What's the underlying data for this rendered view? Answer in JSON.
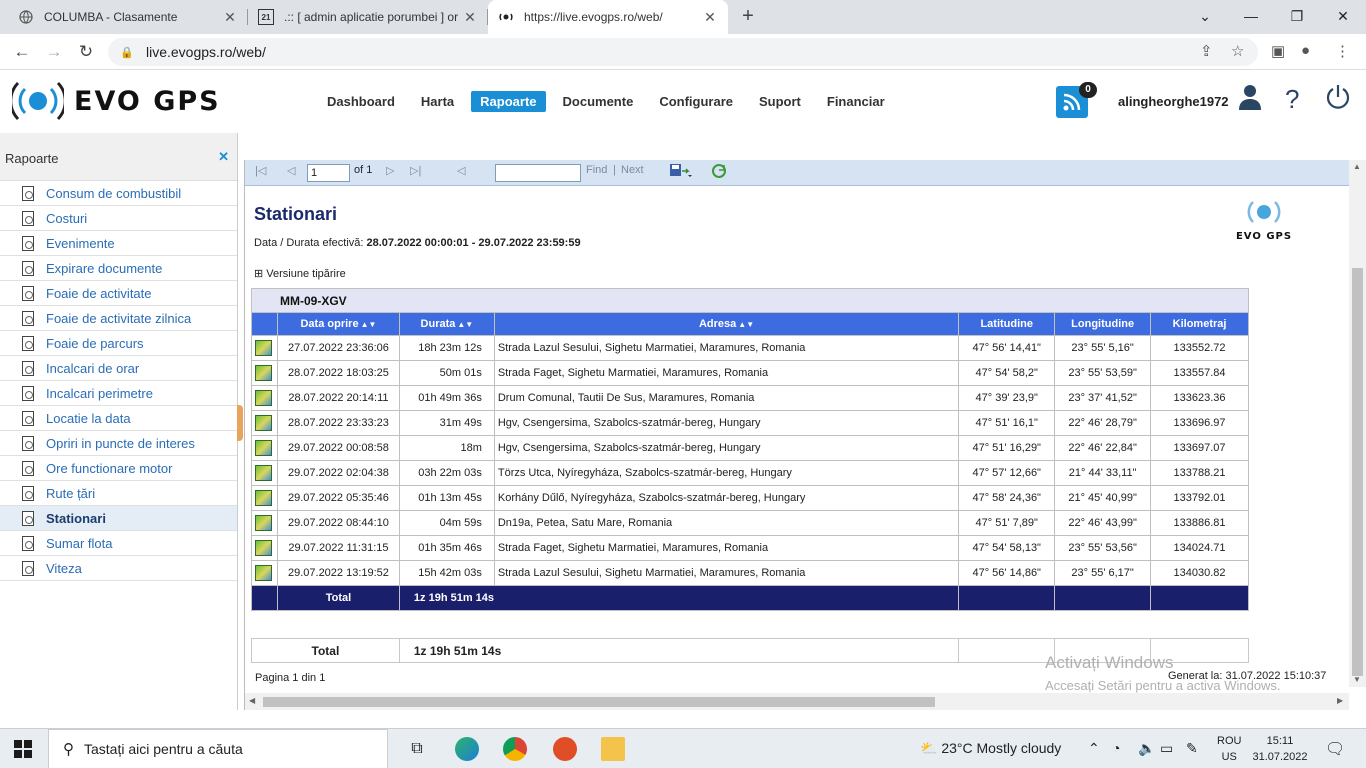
{
  "browser": {
    "tabs": [
      {
        "title": "COLUMBA - Clasamente",
        "icon": "globe-icon"
      },
      {
        "title": ".:: [ admin aplicatie porumbei ] or",
        "icon": "site-icon"
      },
      {
        "title": "https://live.evogps.ro/web/",
        "icon": "evogps-icon"
      }
    ],
    "url": "live.evogps.ro/web/"
  },
  "app": {
    "brand": "EVO GPS",
    "nav": [
      "Dashboard",
      "Harta",
      "Rapoarte",
      "Documente",
      "Configurare",
      "Suport",
      "Financiar"
    ],
    "active_nav": "Rapoarte",
    "notification_count": "0",
    "username": "alingheorghe1972"
  },
  "sidebar": {
    "title": "Rapoarte",
    "items": [
      "Consum de combustibil",
      "Costuri",
      "Evenimente",
      "Expirare documente",
      "Foaie de activitate",
      "Foaie de activitate zilnica",
      "Foaie de parcurs",
      "Incalcari de orar",
      "Incalcari perimetre",
      "Locatie la data",
      "Opriri in puncte de interes",
      "Ore functionare motor",
      "Rute țări",
      "Stationari",
      "Sumar flota",
      "Viteza"
    ],
    "selected": "Stationari"
  },
  "toolbar": {
    "page": "1",
    "of": "of 1",
    "find": "Find",
    "separator": "|",
    "next": "Next"
  },
  "report": {
    "title": "Stationari",
    "period_label": "Data / Durata efectivă:",
    "period_value": "28.07.2022 00:00:01 - 29.07.2022 23:59:59",
    "logo_text": "EVO GPS",
    "print_version": "Versiune tipărire",
    "vehicle": "MM-09-XGV",
    "columns": [
      "Data oprire",
      "Durata",
      "Adresa",
      "Latitudine",
      "Longitudine",
      "Kilometraj"
    ],
    "rows": [
      {
        "date": "27.07.2022 23:36:06",
        "duration": "18h 23m 12s",
        "address": "Strada Lazul Sesului,   Sighetu Marmatiei, Maramures, Romania",
        "lat": "47° 56' 14,41\"",
        "lon": "23° 55' 5,16\"",
        "km": "133552.72"
      },
      {
        "date": "28.07.2022 18:03:25",
        "duration": "50m 01s",
        "address": "Strada Faget,   Sighetu Marmatiei, Maramures, Romania",
        "lat": "47° 54' 58,2\"",
        "lon": "23° 55' 53,59\"",
        "km": "133557.84"
      },
      {
        "date": "28.07.2022 20:14:11",
        "duration": "01h 49m 36s",
        "address": "Drum Comunal,   Tautii De Sus, Maramures, Romania",
        "lat": "47° 39' 23,9\"",
        "lon": "23° 37' 41,52\"",
        "km": "133623.36"
      },
      {
        "date": "28.07.2022 23:33:23",
        "duration": "31m 49s",
        "address": "Hgv,   Csengersima, Szabolcs-szatmár-bereg, Hungary",
        "lat": "47° 51' 16,1\"",
        "lon": "22° 46' 28,79\"",
        "km": "133696.97"
      },
      {
        "date": "29.07.2022 00:08:58",
        "duration": "18m",
        "address": "Hgv,   Csengersima, Szabolcs-szatmár-bereg, Hungary",
        "lat": "47° 51' 16,29\"",
        "lon": "22° 46' 22,84\"",
        "km": "133697.07"
      },
      {
        "date": "29.07.2022 02:04:38",
        "duration": "03h 22m 03s",
        "address": "Törzs Utca,   Nyíregyháza, Szabolcs-szatmár-bereg, Hungary",
        "lat": "47° 57' 12,66\"",
        "lon": "21° 44' 33,11\"",
        "km": "133788.21"
      },
      {
        "date": "29.07.2022 05:35:46",
        "duration": "01h 13m 45s",
        "address": "Korhány Dűlő,   Nyíregyháza, Szabolcs-szatmár-bereg, Hungary",
        "lat": "47° 58' 24,36\"",
        "lon": "21° 45' 40,99\"",
        "km": "133792.01"
      },
      {
        "date": "29.07.2022 08:44:10",
        "duration": "04m 59s",
        "address": "Dn19a,   Petea, Satu Mare, Romania",
        "lat": "47° 51' 7,89\"",
        "lon": "22° 46' 43,99\"",
        "km": "133886.81"
      },
      {
        "date": "29.07.2022 11:31:15",
        "duration": "01h 35m 46s",
        "address": "Strada Faget,   Sighetu Marmatiei, Maramures, Romania",
        "lat": "47° 54' 58,13\"",
        "lon": "23° 55' 53,56\"",
        "km": "134024.71"
      },
      {
        "date": "29.07.2022 13:19:52",
        "duration": "15h 42m 03s",
        "address": "Strada Lazul Sesului,   Sighetu Marmatiei, Maramures, Romania",
        "lat": "47° 56' 14,86\"",
        "lon": "23° 55' 6,17\"",
        "km": "134030.82"
      }
    ],
    "total_label": "Total",
    "total_value": "1z 19h 51m 14s",
    "summary_label": "Total",
    "summary_value": "1z 19h 51m 14s",
    "page_info": "Pagina 1 din 1",
    "generated": "Generat la: 31.07.2022 15:10:37"
  },
  "watermark": {
    "line1": "Activați Windows",
    "line2": "Accesați Setări pentru a activa Windows."
  },
  "taskbar": {
    "search_placeholder": "Tastați aici pentru a căuta",
    "weather": "23°C  Mostly cloudy",
    "lang_1": "ROU",
    "lang_2": "US",
    "time": "15:11",
    "date": "31.07.2022"
  },
  "colors": {
    "accent": "#1a8fd6",
    "table_header": "#3d6ce0",
    "total_row": "#1a1f6b"
  }
}
